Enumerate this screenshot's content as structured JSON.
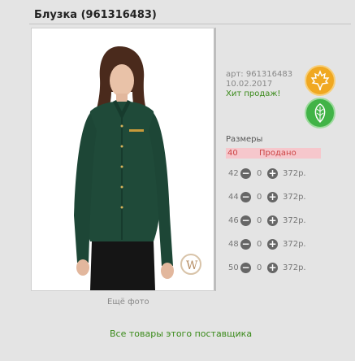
{
  "product": {
    "title": "Блузка (961316483)",
    "article": "арт: 961316483",
    "date": "10.02.2017",
    "hit_label": "Хит продаж!",
    "more_photos": "Ещё фото",
    "watermark": "W"
  },
  "badges": [
    {
      "icon": "maple-leaf-icon",
      "color": "#f0a821"
    },
    {
      "icon": "leaf-icon",
      "color": "#41b347"
    }
  ],
  "sizes": {
    "title": "Размеры",
    "sold_out": {
      "size": "40",
      "label": "Продано"
    },
    "rows": [
      {
        "size": "42",
        "qty": "0",
        "price": "372р."
      },
      {
        "size": "44",
        "qty": "0",
        "price": "372р."
      },
      {
        "size": "46",
        "qty": "0",
        "price": "372р."
      },
      {
        "size": "48",
        "qty": "0",
        "price": "372р."
      },
      {
        "size": "50",
        "qty": "0",
        "price": "372р."
      }
    ]
  },
  "supplier_link": "Все товары этого поставщика"
}
